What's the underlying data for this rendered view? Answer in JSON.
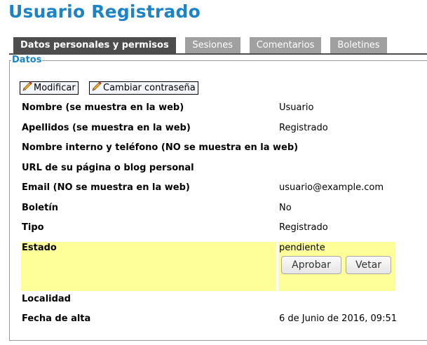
{
  "page": {
    "title": "Usuario Registrado"
  },
  "tabs": [
    {
      "label": "Datos personales y permisos",
      "active": true
    },
    {
      "label": "Sesiones",
      "active": false
    },
    {
      "label": "Comentarios",
      "active": false
    },
    {
      "label": "Boletines",
      "active": false
    }
  ],
  "section": {
    "legend": "Datos"
  },
  "toolbar": {
    "modify_label": "Modificar",
    "change_password_label": "Cambiar contraseña",
    "icon": "pencil-icon"
  },
  "fields": [
    {
      "label": "Nombre (se muestra en la web)",
      "value": "Usuario"
    },
    {
      "label": "Apellidos (se muestra en la web)",
      "value": "Registrado"
    },
    {
      "label": "Nombre interno y teléfono (NO se muestra en la web)",
      "value": ""
    },
    {
      "label": "URL de su página o blog personal",
      "value": ""
    },
    {
      "label": "Email (NO se muestra en la web)",
      "value": "usuario@example.com"
    },
    {
      "label": "Boletín",
      "value": "No"
    },
    {
      "label": "Tipo",
      "value": "Registrado"
    },
    {
      "label": "Estado",
      "value": "pendiente"
    },
    {
      "label": "Localidad",
      "value": ""
    },
    {
      "label": "Fecha de alta",
      "value": "6 de Junio de 2016, 09:51"
    }
  ],
  "status_actions": {
    "approve_label": "Aprobar",
    "veto_label": "Vetar"
  },
  "colors": {
    "title": "#1c84c6",
    "active_tab": "#4d4d4d",
    "inactive_tab": "#a0a0a0",
    "highlight": "#ffff99"
  }
}
